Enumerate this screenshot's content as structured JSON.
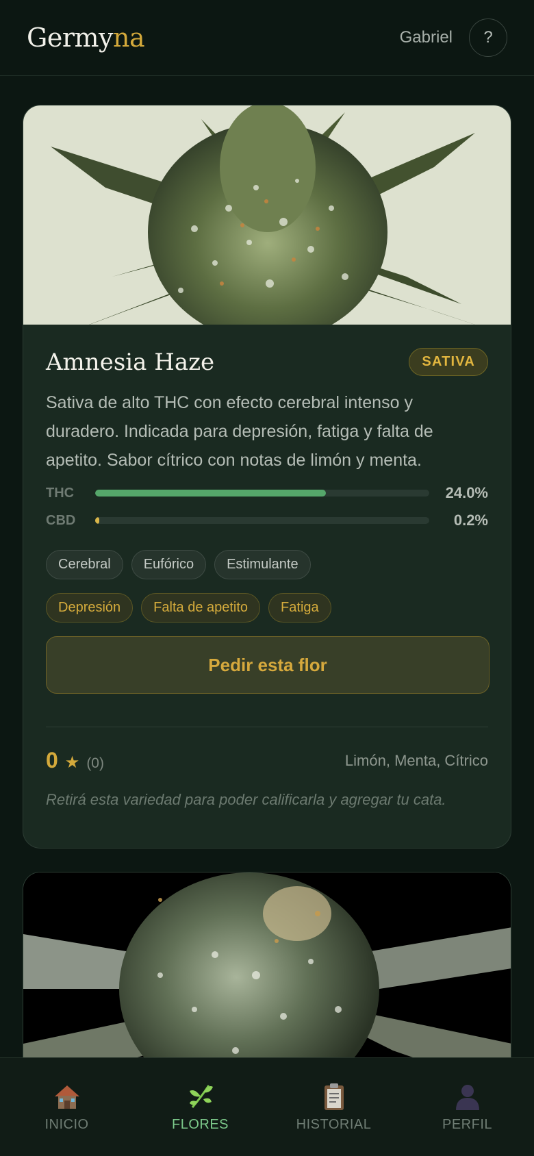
{
  "header": {
    "brand_main": "Germy",
    "brand_accent": "na",
    "username": "Gabriel",
    "help_label": "?"
  },
  "cards": [
    {
      "name": "Amnesia Haze",
      "type": "SATIVA",
      "description": "Sativa de alto THC con efecto cerebral intenso y duradero. Indicada para depresión, fatiga y falta de apetito. Sabor cítrico con notas de limón y menta.",
      "thc_label": "THC",
      "thc_value": "24.0%",
      "thc_fill": 0.69,
      "cbd_label": "CBD",
      "cbd_value": "0.2%",
      "cbd_fill": 0.01,
      "effects": [
        "Cerebral",
        "Eufórico",
        "Estimulante"
      ],
      "conditions": [
        "Depresión",
        "Falta de apetito",
        "Fatiga"
      ],
      "cta_label": "Pedir esta flor",
      "rating": "0",
      "star": "★",
      "rating_count": "(0)",
      "flavors": "Limón, Menta, Cítrico",
      "note": "Retirá esta variedad para poder calificarla y agregar tu cata."
    }
  ],
  "nav": {
    "items": [
      {
        "label": "INICIO",
        "icon": "house-icon"
      },
      {
        "label": "FLORES",
        "icon": "leaf-icon"
      },
      {
        "label": "HISTORIAL",
        "icon": "clipboard-icon"
      },
      {
        "label": "PERFIL",
        "icon": "user-silhouette-icon"
      }
    ],
    "active": "FLORES"
  },
  "colors": {
    "background": "#0c1712",
    "card": "#1a2a21",
    "accent_gold": "#d4a93b",
    "accent_green": "#55a66a"
  }
}
